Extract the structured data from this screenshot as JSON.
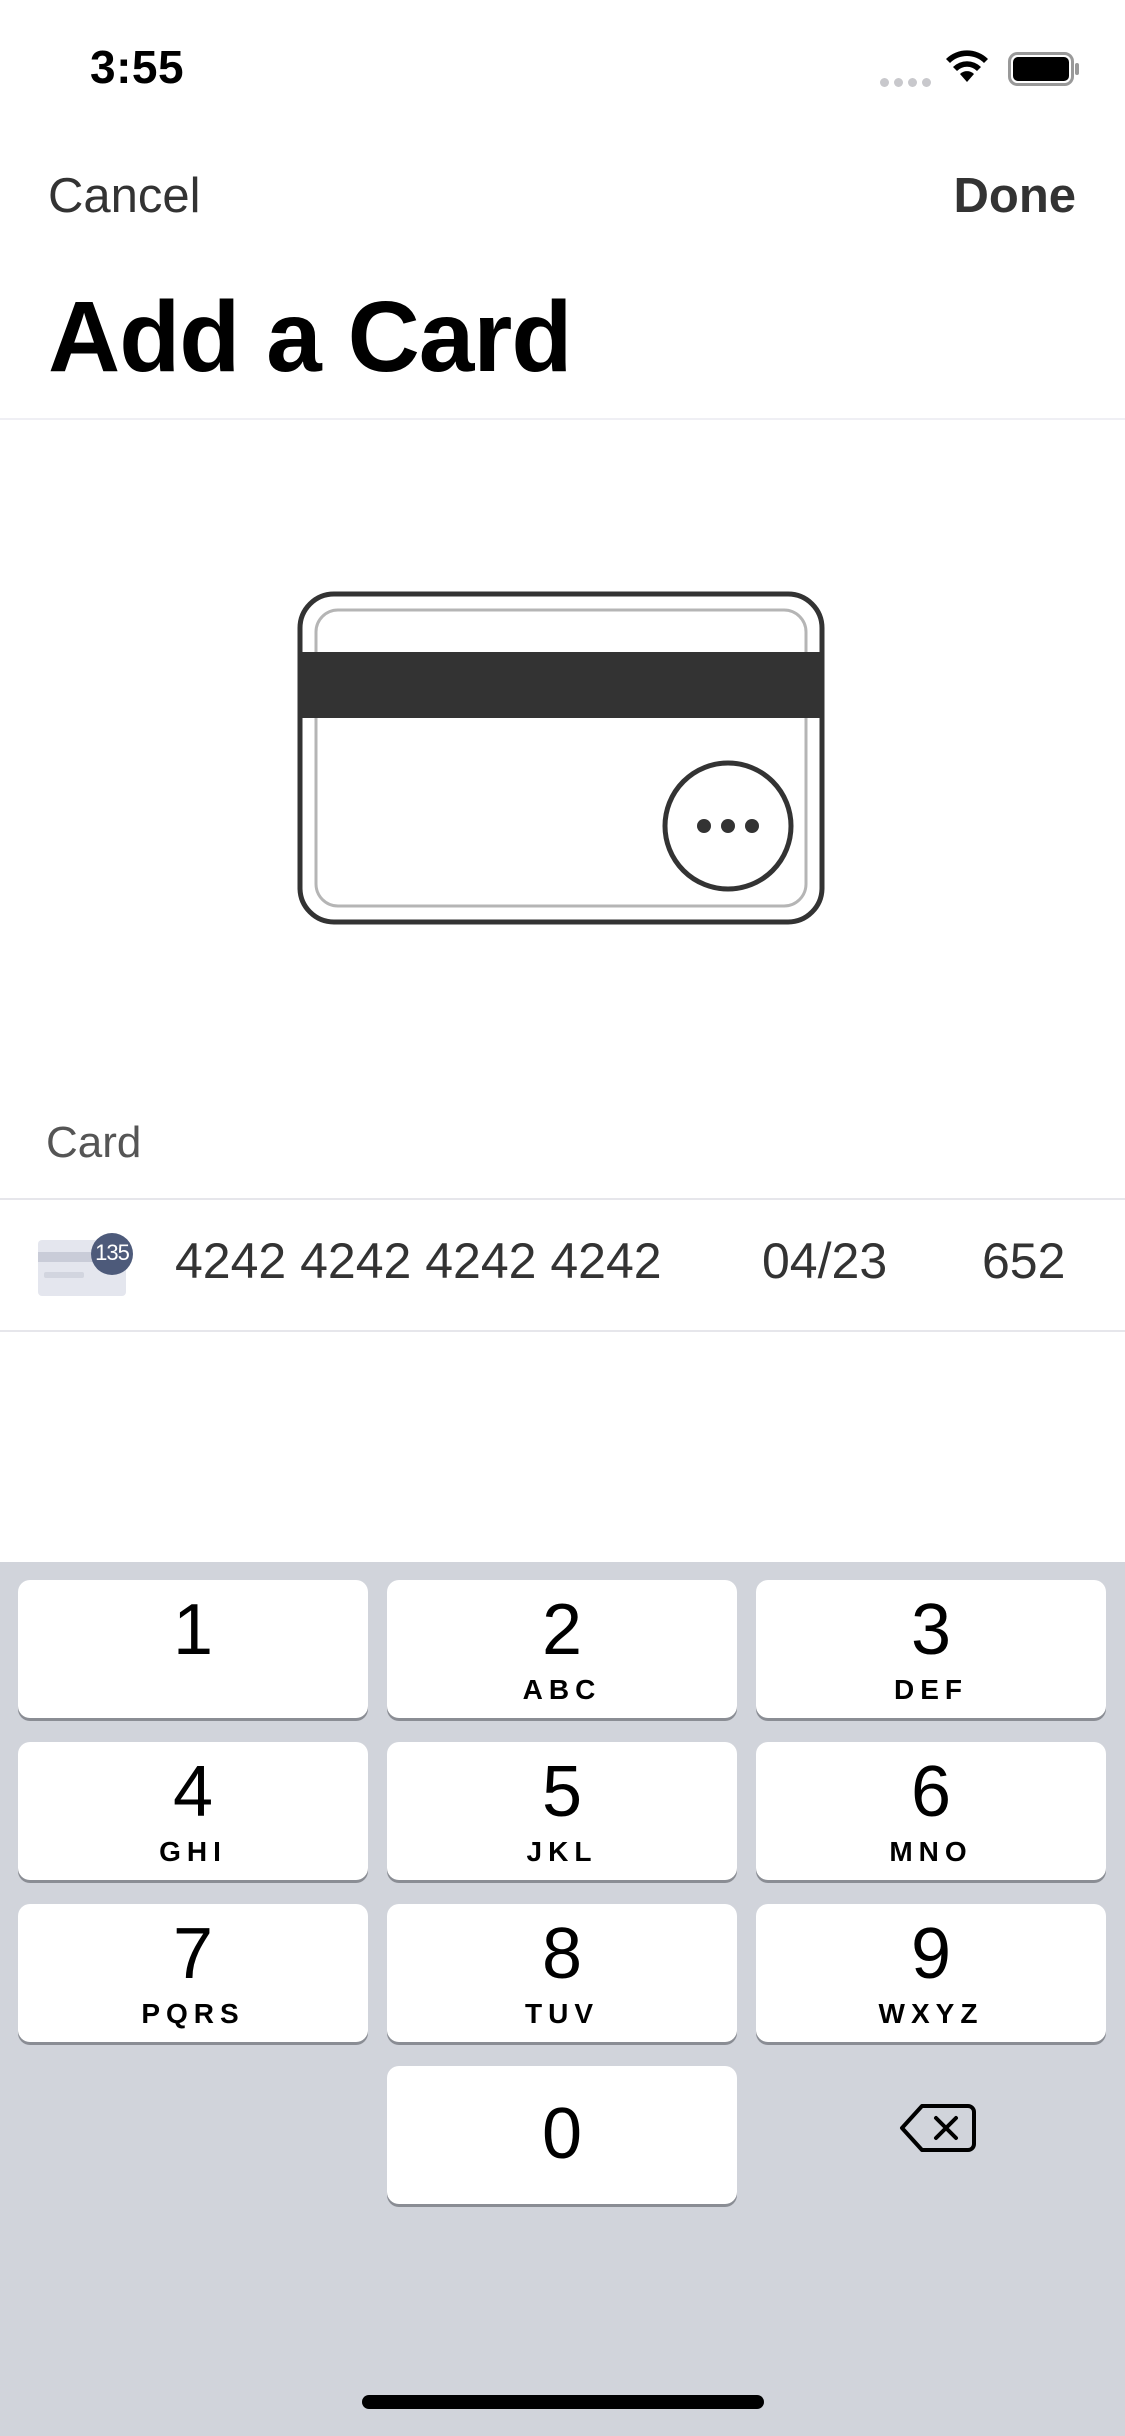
{
  "status": {
    "time": "3:55"
  },
  "nav": {
    "cancel": "Cancel",
    "done": "Done"
  },
  "title": "Add a Card",
  "section_label": "Card",
  "card": {
    "brand_badge": "135",
    "number": "4242 4242 4242 4242",
    "expiry": "04/23",
    "cvc": "652"
  },
  "keypad": {
    "keys": [
      {
        "digit": "1",
        "letters": ""
      },
      {
        "digit": "2",
        "letters": "ABC"
      },
      {
        "digit": "3",
        "letters": "DEF"
      },
      {
        "digit": "4",
        "letters": "GHI"
      },
      {
        "digit": "5",
        "letters": "JKL"
      },
      {
        "digit": "6",
        "letters": "MNO"
      },
      {
        "digit": "7",
        "letters": "PQRS"
      },
      {
        "digit": "8",
        "letters": "TUV"
      },
      {
        "digit": "9",
        "letters": "WXYZ"
      },
      {
        "digit": "0",
        "letters": ""
      }
    ],
    "backspace_icon": "backspace-icon"
  },
  "colors": {
    "keyboard_bg": "#d1d4db",
    "badge_bg": "#4d5a7a",
    "stripe": "#333333"
  }
}
